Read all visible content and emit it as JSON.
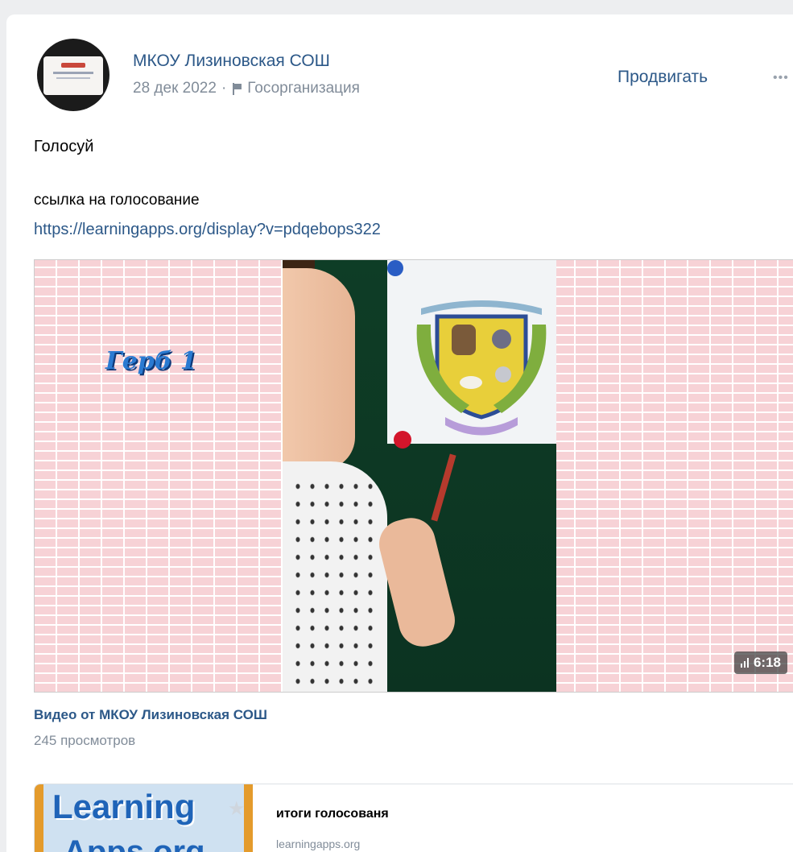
{
  "post": {
    "author": "МКОУ Лизиновская СОШ",
    "date": "28 дек 2022",
    "separator": "·",
    "org_type": "Госорганизация",
    "promote_label": "Продвигать",
    "more_label": "•••",
    "text_line1": "Голосуй",
    "text_line2": "ссылка на голосование",
    "link": "https://learningapps.org/display?v=pdqebops322"
  },
  "video": {
    "overlay_title": "Герб 1",
    "duration": "6:18",
    "title": "Видео от МКОУ Лизиновская СОШ",
    "views": "245 просмотров"
  },
  "snippet": {
    "thumb_line1": "Learning",
    "thumb_line2": "Apps.org",
    "title": "итоги голосованя",
    "domain": "learningapps.org"
  },
  "colors": {
    "link": "#2c5888",
    "muted": "#818c99",
    "page_bg": "#edeef0"
  }
}
